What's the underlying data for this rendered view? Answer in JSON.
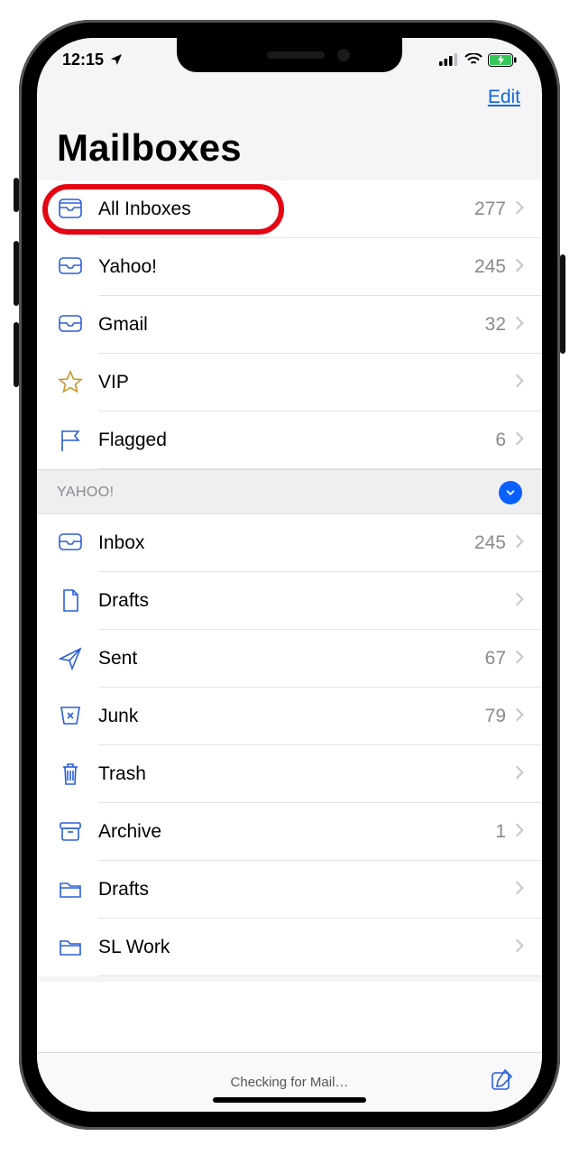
{
  "status_bar": {
    "time": "12:15"
  },
  "nav": {
    "edit": "Edit"
  },
  "title": "Mailboxes",
  "top_mailboxes": [
    {
      "icon": "cabinet",
      "label": "All Inboxes",
      "count": "277",
      "highlighted": true
    },
    {
      "icon": "tray",
      "label": "Yahoo!",
      "count": "245"
    },
    {
      "icon": "tray",
      "label": "Gmail",
      "count": "32"
    },
    {
      "icon": "star",
      "label": "VIP",
      "count": ""
    },
    {
      "icon": "flag",
      "label": "Flagged",
      "count": "6"
    }
  ],
  "section": {
    "header": "YAHOO!",
    "expanded": true,
    "items": [
      {
        "icon": "tray",
        "label": "Inbox",
        "count": "245"
      },
      {
        "icon": "doc",
        "label": "Drafts",
        "count": ""
      },
      {
        "icon": "send",
        "label": "Sent",
        "count": "67"
      },
      {
        "icon": "junk",
        "label": "Junk",
        "count": "79"
      },
      {
        "icon": "trash",
        "label": "Trash",
        "count": ""
      },
      {
        "icon": "archive",
        "label": "Archive",
        "count": "1"
      },
      {
        "icon": "folder",
        "label": "Drafts",
        "count": ""
      },
      {
        "icon": "folder",
        "label": "SL Work",
        "count": ""
      }
    ]
  },
  "toolbar": {
    "status": "Checking for Mail…"
  }
}
